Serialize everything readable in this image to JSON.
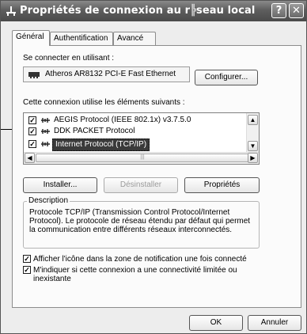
{
  "window": {
    "title": "Propriétés de connexion au r╠seau local",
    "help_glyph": "?",
    "close_glyph": "✕"
  },
  "tabs": [
    {
      "label": "Général",
      "active": true
    },
    {
      "label": "Authentification",
      "active": false
    },
    {
      "label": "Avancé",
      "active": false
    }
  ],
  "connect": {
    "label": "Se connecter en utilisant :",
    "adapter": "Atheros AR8132 PCI-E Fast Ethernet",
    "configure_button": "Configurer..."
  },
  "components": {
    "label": "Cette connexion utilise les éléments suivants :",
    "items": [
      {
        "label": "AEGIS Protocol (IEEE 802.1x) v3.7.5.0",
        "checked": true,
        "selected": false
      },
      {
        "label": "DDK PACKET Protocol",
        "checked": true,
        "selected": false
      },
      {
        "label": "Internet Protocol (TCP/IP)",
        "checked": true,
        "selected": true
      }
    ],
    "check_glyph": "✓",
    "scroll_up": "▲",
    "scroll_down": "▼",
    "scroll_left": "◀",
    "scroll_right": "▶",
    "thumb_grip": "|||"
  },
  "actions": {
    "install": "Installer...",
    "uninstall": "Désinstaller",
    "properties": "Propriétés"
  },
  "description": {
    "legend": "Description",
    "text": "Protocole TCP/IP (Transmission Control Protocol/Internet Protocol). Le protocole de réseau étendu par défaut qui permet la communication entre différents réseaux interconnectés."
  },
  "options": [
    {
      "label": "Afficher l'icône dans la zone de notification une fois connecté",
      "checked": true
    },
    {
      "label": "M'indiquer si cette connexion a une connectivité limitée ou inexistante",
      "checked": true
    }
  ],
  "footer": {
    "ok": "OK",
    "cancel": "Annuler"
  }
}
